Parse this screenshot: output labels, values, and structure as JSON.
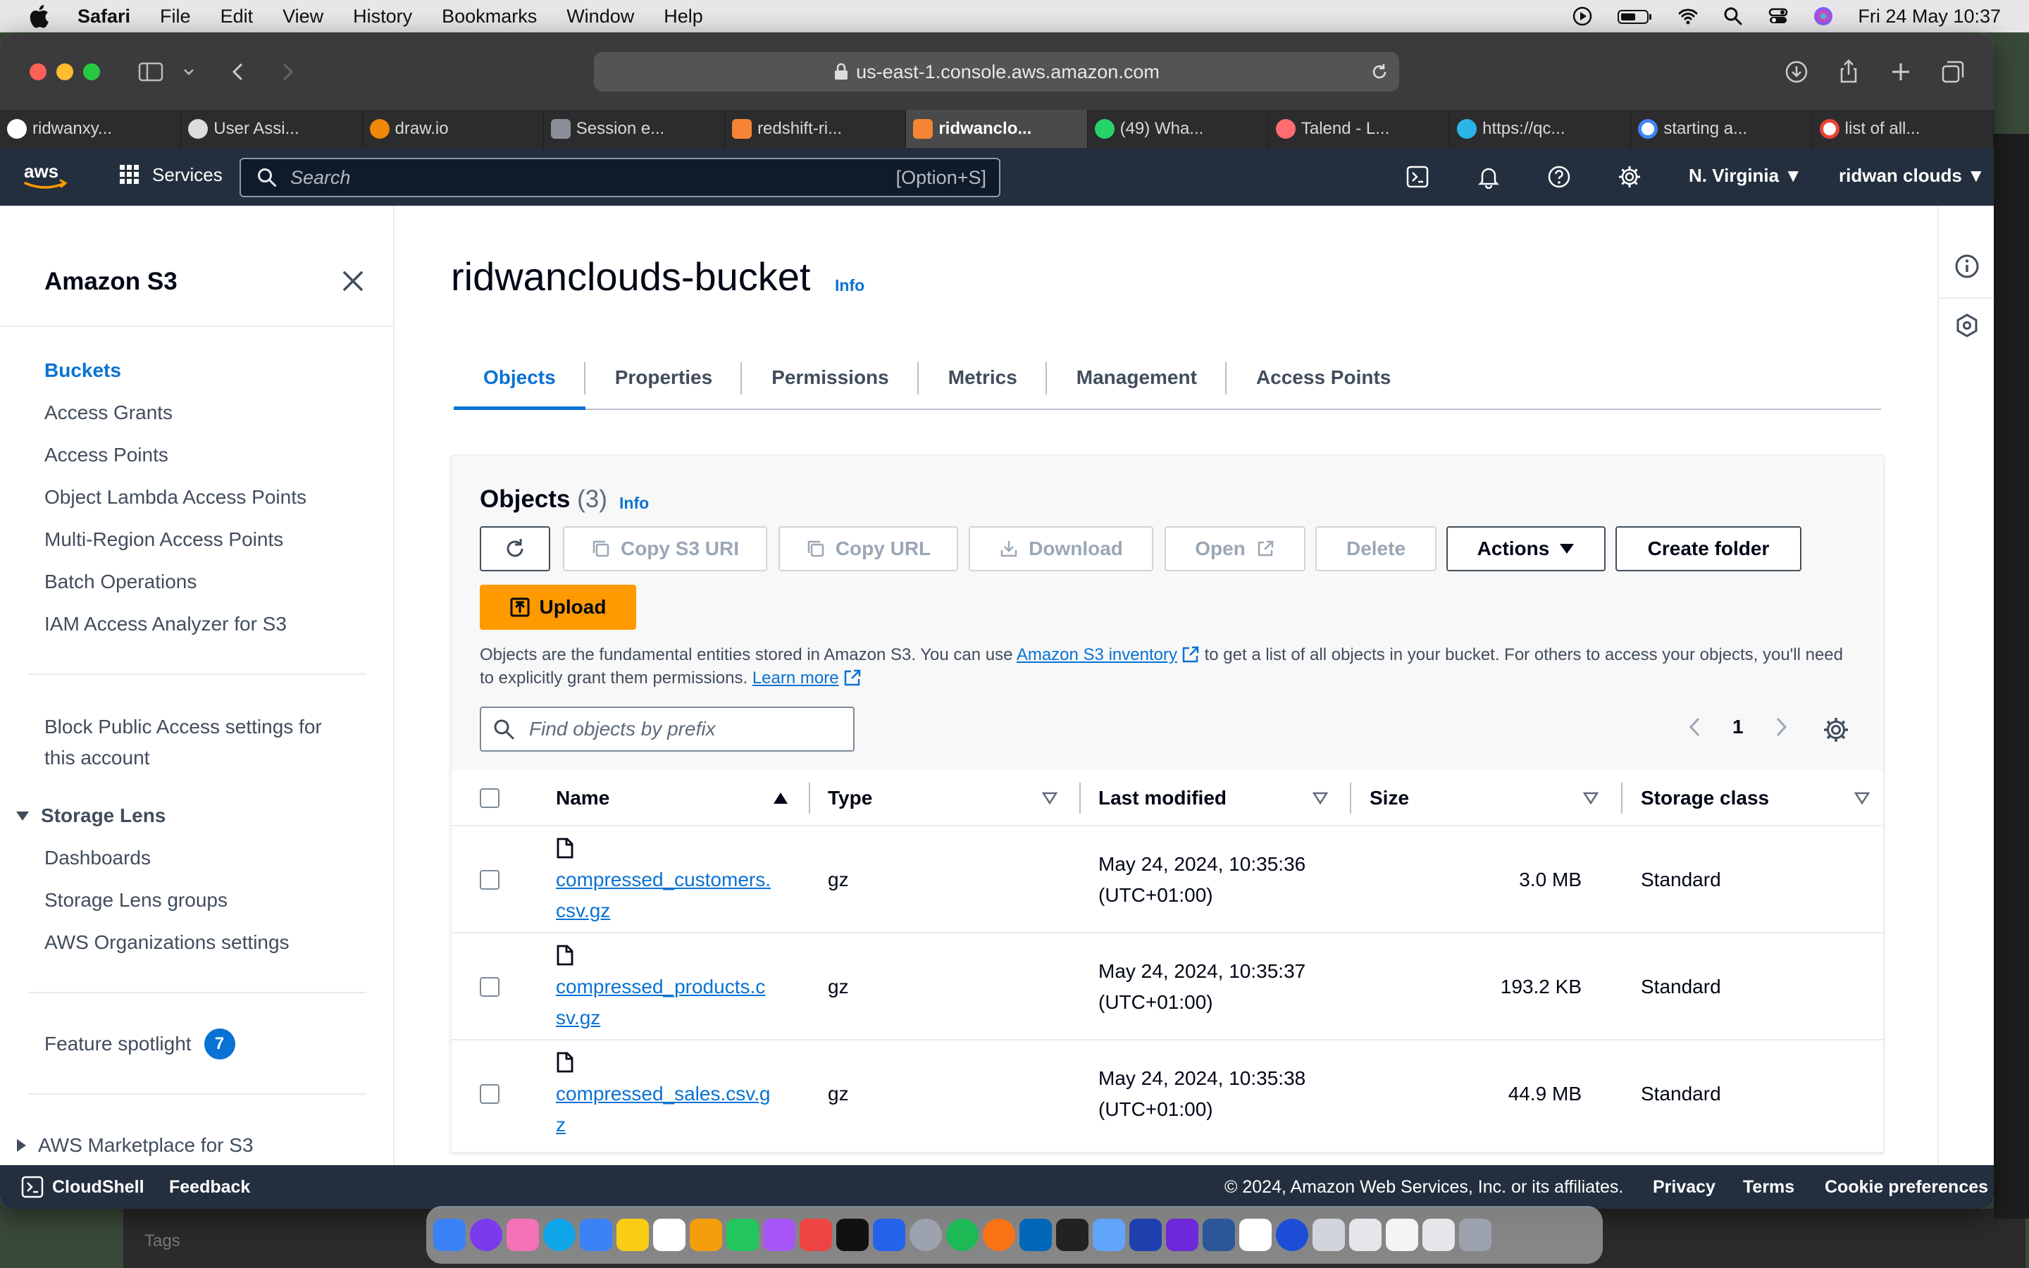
{
  "menubar": {
    "app": "Safari",
    "items": [
      "File",
      "Edit",
      "View",
      "History",
      "Bookmarks",
      "Window",
      "Help"
    ],
    "clock": "Fri 24 May  10:37"
  },
  "browser": {
    "url": "us-east-1.console.aws.amazon.com",
    "tabs": [
      {
        "label": "ridwanxy...",
        "color": "#111111"
      },
      {
        "label": "User Assi...",
        "color": "#444444"
      },
      {
        "label": "draw.io",
        "color": "#f08705"
      },
      {
        "label": "Session e...",
        "color": "#8a8f98"
      },
      {
        "label": "redshift-ri...",
        "color": "#f58534"
      },
      {
        "label": "ridwanclo...",
        "color": "#f58534"
      },
      {
        "label": "(49) Wha...",
        "color": "#25d366"
      },
      {
        "label": "Talend - L...",
        "color": "#ff6d70"
      },
      {
        "label": "https://qc...",
        "color": "#29b5e8"
      },
      {
        "label": "starting a...",
        "color": "#ffffff"
      },
      {
        "label": "list of all...",
        "color": "#ffffff"
      }
    ]
  },
  "awsnav": {
    "services": "Services",
    "search_placeholder": "Search",
    "search_shortcut": "[Option+S]",
    "region": "N. Virginia",
    "account": "ridwan clouds"
  },
  "sidebar": {
    "title": "Amazon S3",
    "items": [
      "Buckets",
      "Access Grants",
      "Access Points",
      "Object Lambda Access Points",
      "Multi-Region Access Points",
      "Batch Operations",
      "IAM Access Analyzer for S3"
    ],
    "block_public_line1": "Block Public Access settings for",
    "block_public_line2": "this account",
    "storage_lens": {
      "title": "Storage Lens",
      "items": [
        "Dashboards",
        "Storage Lens groups",
        "AWS Organizations settings"
      ]
    },
    "feature_spotlight": "Feature spotlight",
    "feature_count": "7",
    "marketplace": "AWS Marketplace for S3"
  },
  "main": {
    "bucket_name": "ridwanclouds-bucket",
    "info": "Info",
    "tabs": [
      "Objects",
      "Properties",
      "Permissions",
      "Metrics",
      "Management",
      "Access Points"
    ],
    "objects": {
      "title": "Objects",
      "count": "(3)",
      "info": "Info",
      "buttons": {
        "copy_s3_uri": "Copy S3 URI",
        "copy_url": "Copy URL",
        "download": "Download",
        "open": "Open",
        "delete": "Delete",
        "actions": "Actions",
        "create_folder": "Create folder",
        "upload": "Upload"
      },
      "description_1": "Objects are the fundamental entities stored in Amazon S3. You can use ",
      "inventory_link": "Amazon S3 inventory",
      "description_2": " to get a list of all objects in your bucket. For others to access your objects, you'll need to explicitly grant them permissions. ",
      "learn_more": "Learn more",
      "filter_placeholder": "Find objects by prefix",
      "page": "1",
      "columns": [
        "Name",
        "Type",
        "Last modified",
        "Size",
        "Storage class"
      ],
      "rows": [
        {
          "name_1": "compressed_customers.",
          "name_2": "csv.gz",
          "type": "gz",
          "modified_1": "May 24, 2024, 10:35:36",
          "modified_2": "(UTC+01:00)",
          "size": "3.0 MB",
          "storage": "Standard"
        },
        {
          "name_1": "compressed_products.c",
          "name_2": "sv.gz",
          "type": "gz",
          "modified_1": "May 24, 2024, 10:35:37",
          "modified_2": "(UTC+01:00)",
          "size": "193.2 KB",
          "storage": "Standard"
        },
        {
          "name_1": "compressed_sales.csv.g",
          "name_2": "z",
          "type": "gz",
          "modified_1": "May 24, 2024, 10:35:38",
          "modified_2": "(UTC+01:00)",
          "size": "44.9 MB",
          "storage": "Standard"
        }
      ]
    }
  },
  "footer": {
    "cloudshell": "CloudShell",
    "feedback": "Feedback",
    "copyright": "© 2024, Amazon Web Services, Inc. or its affiliates.",
    "privacy": "Privacy",
    "terms": "Terms",
    "cookies": "Cookie preferences"
  },
  "backdrop": {
    "tags": "Tags"
  },
  "colors": {
    "aws_dark": "#232f3e",
    "link_blue": "#0972d3",
    "upload_orange": "#ff9900"
  }
}
